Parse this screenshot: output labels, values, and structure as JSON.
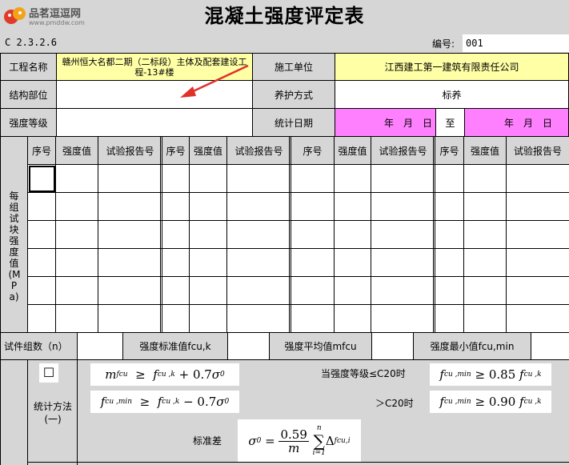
{
  "logo": {
    "name": "品茗逗逗网",
    "url": "www.pmddw.com"
  },
  "title": "混凝土强度评定表",
  "code": "C 2.3.2.6",
  "number_label": "编号:",
  "number_value": "001",
  "info": {
    "project_label": "工程名称",
    "project_value": "赣州恒大名都二期（二标段）主体及配套建设工程-13#楼",
    "contractor_label": "施工单位",
    "contractor_value": "江西建工第一建筑有限责任公司",
    "structure_label": "结构部位",
    "structure_value": "",
    "curing_label": "养护方式",
    "curing_value": "标养",
    "grade_label": "强度等级",
    "grade_value": "",
    "stat_date_label": "统计日期",
    "date_from": "年　月　日",
    "date_to_label": "至",
    "date_to": "年　月　日"
  },
  "side_label": "每组试块强度值(MPa)",
  "table": {
    "headers": [
      "序号",
      "强度值",
      "试验报告号",
      "序号",
      "强度值",
      "试验报告号",
      "序号",
      "强度值",
      "试验报告号",
      "序号",
      "强度值",
      "试验报告号"
    ]
  },
  "summary": {
    "groups_label": "试件组数（n）",
    "standard_label": "强度标准值fcu,k",
    "mean_label": "强度平均值mfcu",
    "min_label": "强度最小值fcu,min"
  },
  "method": {
    "label": "统计方法(一)",
    "checkbox": "☐",
    "cond1": "当强度等级≤C20时",
    "cond2": "＞C20时",
    "std_label": "标准差",
    "f1_coef": "0.7",
    "f2_coef": "0.7",
    "c1_coef": "0.85",
    "c2_coef": "0.90",
    "sd_num": "0.59",
    "sd_den": "m",
    "sd_top": "n",
    "sd_bottom": "i=1"
  },
  "colors": {
    "yellow": "#ffffa6",
    "pink": "#ff80ff",
    "gray": "#d6d6d6"
  }
}
